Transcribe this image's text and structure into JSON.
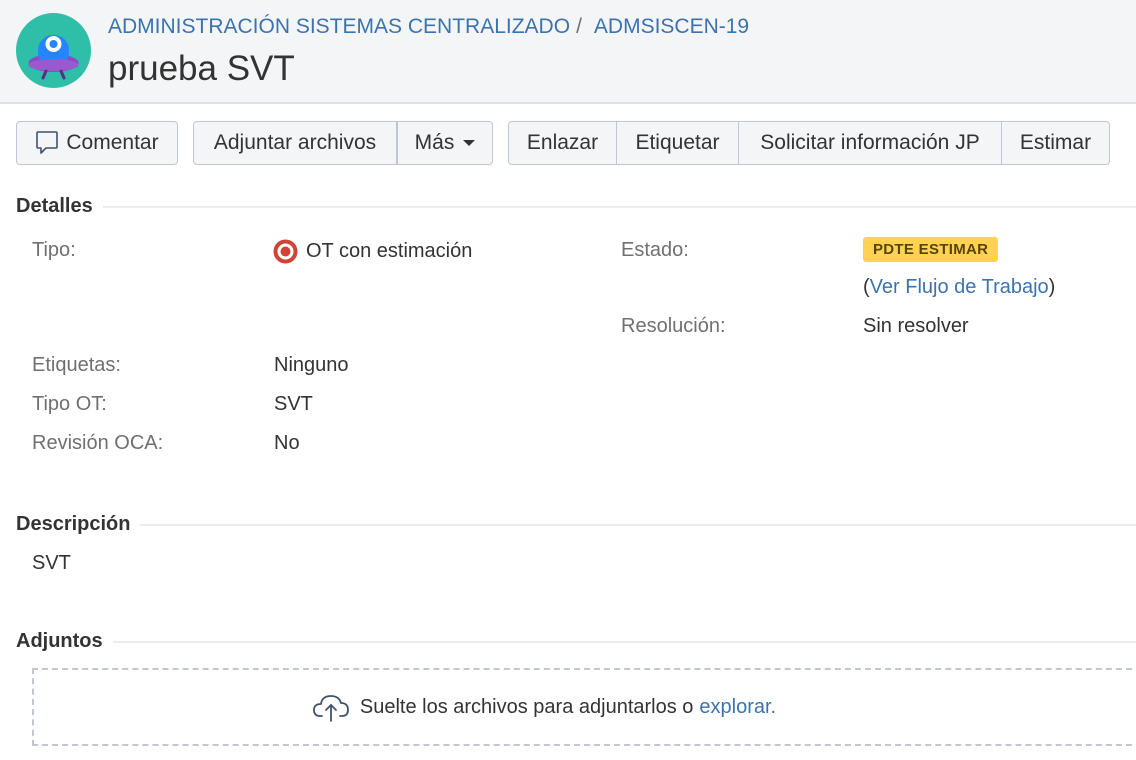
{
  "header": {
    "project": "ADMINISTRACIÓN SISTEMAS CENTRALIZADO",
    "separator": "/",
    "issue_key": "ADMSISCEN-19",
    "title": "prueba SVT"
  },
  "toolbar": {
    "comment": "Comentar",
    "attach": "Adjuntar archivos",
    "more": "Más",
    "link": "Enlazar",
    "label": "Etiquetar",
    "request_info": "Solicitar información JP",
    "estimate": "Estimar"
  },
  "details": {
    "section": "Detalles",
    "type_label": "Tipo:",
    "type_value": "OT con estimación",
    "status_label": "Estado:",
    "status_value": "PDTE ESTIMAR",
    "status_colors": {
      "bg": "#ffd351",
      "fg": "#594300"
    },
    "workflow_open": "(",
    "workflow_link": "Ver Flujo de Trabajo",
    "workflow_close": ")",
    "resolution_label": "Resolución:",
    "resolution_value": "Sin resolver",
    "labels_label": "Etiquetas:",
    "labels_value": "Ninguno",
    "ot_type_label": "Tipo OT:",
    "ot_type_value": "SVT",
    "oca_label": "Revisión OCA:",
    "oca_value": "No"
  },
  "description": {
    "section": "Descripción",
    "text": "SVT"
  },
  "attachments": {
    "section": "Adjuntos",
    "drop_text": "Suelte los archivos para adjuntarlos o ",
    "browse": "explorar."
  },
  "icons": {
    "avatar": "project-avatar-icon",
    "comment": "comment-icon",
    "type": "target-icon",
    "upload": "cloud-upload-icon"
  },
  "colors": {
    "link": "#3b73af",
    "text": "#333333",
    "muted": "#707070"
  }
}
